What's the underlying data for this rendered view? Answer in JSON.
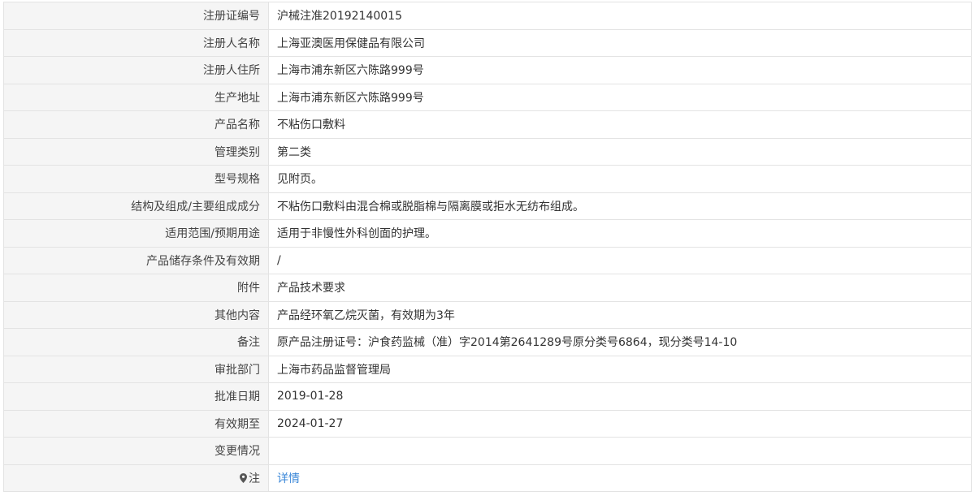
{
  "colors": {
    "border": "#e3e3e3",
    "label_bg": "#f5f5f5",
    "label_text": "#444444",
    "value_text": "#333333",
    "link": "#3a87d8",
    "icon": "#555555"
  },
  "rows": [
    {
      "label": "注册证编号",
      "value": "沪械注准20192140015"
    },
    {
      "label": "注册人名称",
      "value": "上海亚澳医用保健品有限公司"
    },
    {
      "label": "注册人住所",
      "value": "上海市浦东新区六陈路999号"
    },
    {
      "label": "生产地址",
      "value": "上海市浦东新区六陈路999号"
    },
    {
      "label": "产品名称",
      "value": "不粘伤口敷料"
    },
    {
      "label": "管理类别",
      "value": "第二类"
    },
    {
      "label": "型号规格",
      "value": "见附页。"
    },
    {
      "label": "结构及组成/主要组成成分",
      "value": "不粘伤口敷料由混合棉或脱脂棉与隔离膜或拒水无纺布组成。"
    },
    {
      "label": "适用范围/预期用途",
      "value": "适用于非慢性外科创面的护理。"
    },
    {
      "label": "产品储存条件及有效期",
      "value": "/"
    },
    {
      "label": "附件",
      "value": "产品技术要求"
    },
    {
      "label": "其他内容",
      "value": "产品经环氧乙烷灭菌，有效期为3年"
    },
    {
      "label": "备注",
      "value": "原产品注册证号：沪食药监械（准）字2014第2641289号原分类号6864，现分类号14-10"
    },
    {
      "label": "审批部门",
      "value": "上海市药品监督管理局"
    },
    {
      "label": "批准日期",
      "value": "2019-01-28"
    },
    {
      "label": "有效期至",
      "value": "2024-01-27"
    },
    {
      "label": "变更情况"
    }
  ],
  "note_row": {
    "icon": "map-pin-icon",
    "label": "注",
    "link": "详情"
  }
}
